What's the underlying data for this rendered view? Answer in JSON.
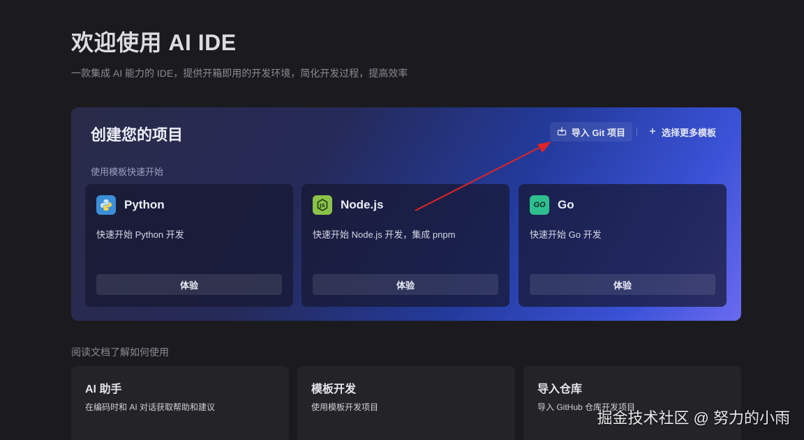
{
  "header": {
    "title": "欢迎使用 AI IDE",
    "subtitle": "一款集成 AI 能力的 IDE，提供开箱即用的开发环境，简化开发过程，提高效率"
  },
  "hero": {
    "title": "创建您的项目",
    "import_git_label": "导入 Git 项目",
    "more_templates_label": "选择更多模板",
    "hint": "使用模板快速开始"
  },
  "templates": [
    {
      "name": "Python",
      "description": "快速开始 Python 开发",
      "button": "体验",
      "icon": "python-icon",
      "color": "#3b8fd9"
    },
    {
      "name": "Node.js",
      "description": "快速开始 Node.js 开发，集成 pnpm",
      "button": "体验",
      "icon": "nodejs-icon",
      "color": "#8bc34a"
    },
    {
      "name": "Go",
      "description": "快速开始 Go 开发",
      "button": "体验",
      "icon": "go-icon",
      "color": "#2fbf8f",
      "icon_text": "GO"
    }
  ],
  "docs": {
    "hint": "阅读文档了解如何使用",
    "cards": [
      {
        "title": "AI 助手",
        "description": "在编码时和 AI 对话获取帮助和建议"
      },
      {
        "title": "模板开发",
        "description": "使用模板开发项目"
      },
      {
        "title": "导入仓库",
        "description": "导入 GitHub 仓库开发项目"
      }
    ]
  },
  "watermark": "掘金技术社区 @ 努力的小雨",
  "colors": {
    "annotation_arrow": "#e02424",
    "background": "#1b1b1f"
  }
}
